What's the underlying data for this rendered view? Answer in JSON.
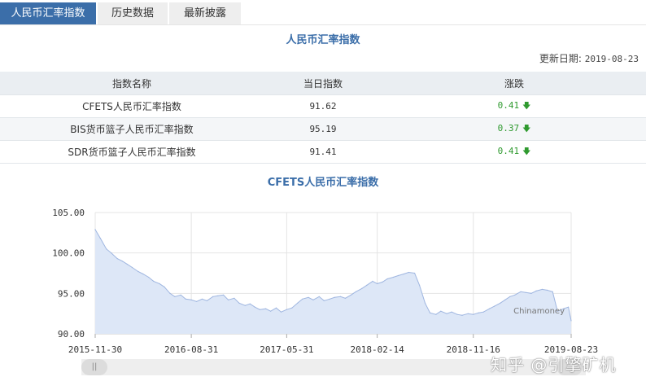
{
  "tabs": [
    {
      "label": "人民币汇率指数",
      "active": true
    },
    {
      "label": "历史数据",
      "active": false
    },
    {
      "label": "最新披露",
      "active": false
    }
  ],
  "title": "人民币汇率指数",
  "update": {
    "label": "更新日期:",
    "date": "2019-08-23"
  },
  "table": {
    "headers": [
      "指数名称",
      "当日指数",
      "涨跌"
    ],
    "rows": [
      {
        "name": "CFETS人民币汇率指数",
        "value": "91.62",
        "change": "0.41",
        "arrow": "down"
      },
      {
        "name": "BIS货币篮子人民币汇率指数",
        "value": "95.19",
        "change": "0.37",
        "arrow": "down"
      },
      {
        "name": "SDR货币篮子人民币汇率指数",
        "value": "91.41",
        "change": "0.41",
        "arrow": "down"
      }
    ]
  },
  "colors": {
    "accent": "#3b6ea9",
    "down": "#2f9a2f",
    "area_fill": "#dde7f7",
    "area_line": "#9fb6e0"
  },
  "chart_data": {
    "type": "area",
    "title": "CFETS人民币汇率指数",
    "credit": "Chinamoney",
    "ylim": [
      90,
      105
    ],
    "yticks": [
      "105.00",
      "100.00",
      "95.00",
      "90.00"
    ],
    "xticks": [
      "2015-11-30",
      "2016-08-31",
      "2017-05-31",
      "2018-02-14",
      "2018-11-16",
      "2019-08-23"
    ],
    "grid": true,
    "series": [
      {
        "x": [
          "2015-11-30",
          "2015-12-15",
          "2016-01-01",
          "2016-01-15",
          "2016-02-01",
          "2016-02-15",
          "2016-03-01",
          "2016-03-15",
          "2016-04-01",
          "2016-04-15",
          "2016-05-01",
          "2016-05-15",
          "2016-06-01",
          "2016-06-15",
          "2016-07-01",
          "2016-07-15",
          "2016-08-01",
          "2016-08-15",
          "2016-08-31",
          "2016-09-15",
          "2016-10-01",
          "2016-10-15",
          "2016-11-01",
          "2016-11-15",
          "2016-12-01",
          "2016-12-15",
          "2017-01-01",
          "2017-01-15",
          "2017-02-01",
          "2017-02-15",
          "2017-03-01",
          "2017-03-15",
          "2017-04-01",
          "2017-04-15",
          "2017-05-01",
          "2017-05-15",
          "2017-05-31",
          "2017-06-15",
          "2017-07-01",
          "2017-07-15",
          "2017-08-01",
          "2017-08-15",
          "2017-09-01",
          "2017-09-15",
          "2017-10-01",
          "2017-10-15",
          "2017-11-01",
          "2017-11-15",
          "2017-12-01",
          "2017-12-15",
          "2018-01-01",
          "2018-01-15",
          "2018-02-01",
          "2018-02-14",
          "2018-03-01",
          "2018-03-15",
          "2018-04-01",
          "2018-04-15",
          "2018-05-01",
          "2018-05-15",
          "2018-06-01",
          "2018-06-15",
          "2018-07-01",
          "2018-07-15",
          "2018-08-01",
          "2018-08-15",
          "2018-09-01",
          "2018-09-15",
          "2018-10-01",
          "2018-10-15",
          "2018-11-01",
          "2018-11-16",
          "2018-12-01",
          "2018-12-15",
          "2019-01-01",
          "2019-01-15",
          "2019-02-01",
          "2019-02-15",
          "2019-03-01",
          "2019-03-15",
          "2019-04-01",
          "2019-04-15",
          "2019-05-01",
          "2019-05-15",
          "2019-06-01",
          "2019-06-15",
          "2019-07-01",
          "2019-07-15",
          "2019-08-01",
          "2019-08-15",
          "2019-08-23"
        ],
        "values": [
          102.9,
          101.8,
          100.5,
          100.0,
          99.3,
          99.0,
          98.6,
          98.2,
          97.7,
          97.4,
          97.0,
          96.5,
          96.2,
          95.8,
          95.0,
          94.6,
          94.8,
          94.3,
          94.2,
          94.0,
          94.3,
          94.1,
          94.6,
          94.7,
          94.8,
          94.2,
          94.4,
          93.8,
          93.5,
          93.7,
          93.3,
          93.0,
          93.1,
          92.8,
          93.2,
          92.7,
          93.0,
          93.2,
          93.8,
          94.3,
          94.5,
          94.2,
          94.6,
          94.1,
          94.3,
          94.5,
          94.6,
          94.4,
          94.8,
          95.2,
          95.6,
          96.0,
          96.5,
          96.2,
          96.4,
          96.8,
          97.0,
          97.2,
          97.4,
          97.6,
          97.5,
          96.0,
          93.8,
          92.6,
          92.4,
          92.8,
          92.5,
          92.7,
          92.4,
          92.3,
          92.5,
          92.4,
          92.6,
          92.7,
          93.1,
          93.4,
          93.8,
          94.2,
          94.6,
          94.8,
          95.2,
          95.1,
          95.0,
          95.3,
          95.5,
          95.4,
          95.2,
          92.8,
          93.1,
          93.3,
          91.62
        ]
      }
    ]
  },
  "watermark": "知乎 @引擎矿机"
}
